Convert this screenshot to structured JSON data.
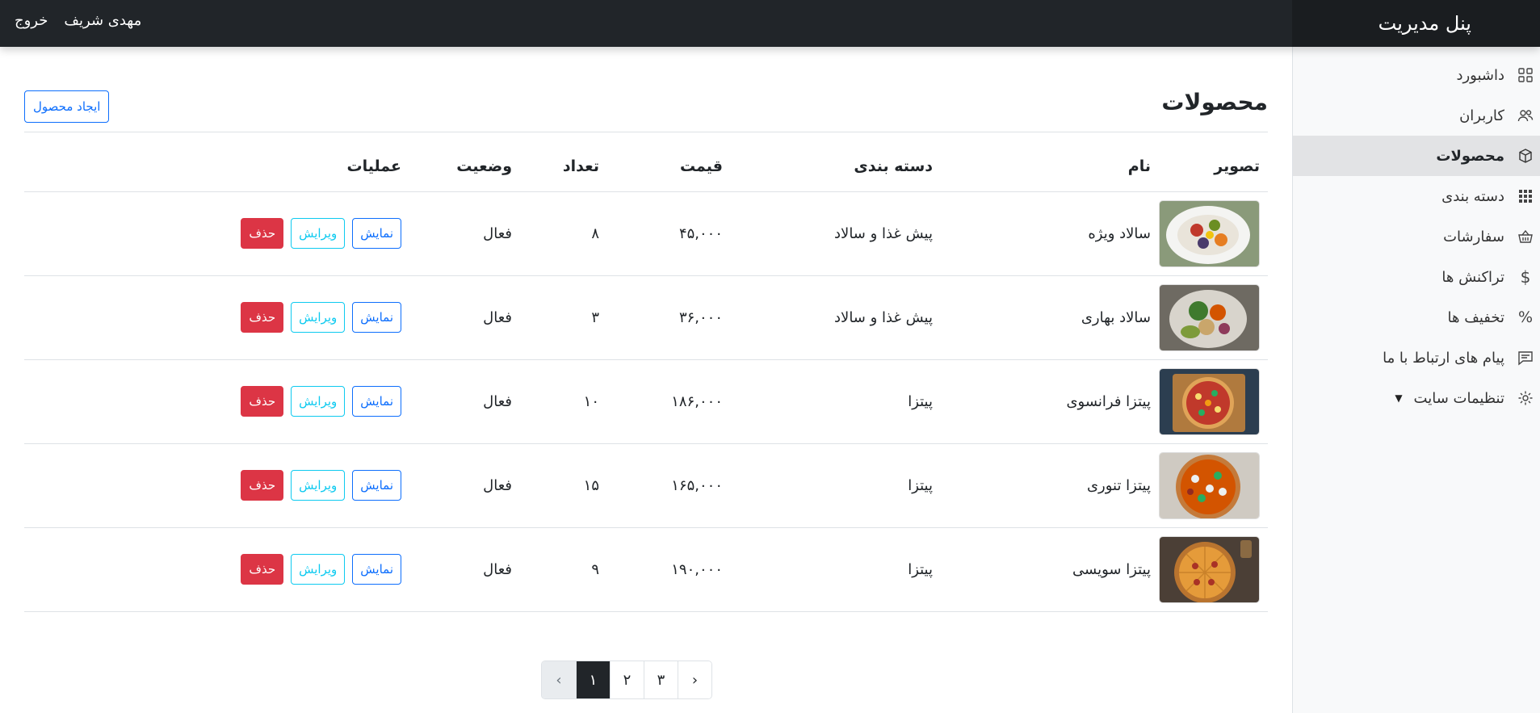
{
  "brand": "پنل مدیریت",
  "user": {
    "name": "مهدی شریف",
    "logout": "خروج"
  },
  "sidebar": {
    "items": [
      {
        "label": "داشبورد",
        "icon": "grid-icon"
      },
      {
        "label": "کاربران",
        "icon": "users-icon"
      },
      {
        "label": "محصولات",
        "icon": "box-icon",
        "active": true
      },
      {
        "label": "دسته بندی",
        "icon": "apps-grid-icon"
      },
      {
        "label": "سفارشات",
        "icon": "basket-icon"
      },
      {
        "label": "تراکنش ها",
        "icon": "dollar-icon"
      },
      {
        "label": "تخفیف ها",
        "icon": "percent-icon"
      },
      {
        "label": "پیام های ارتباط با ما",
        "icon": "message-icon"
      },
      {
        "label": "تنظیمات سایت",
        "icon": "gear-icon",
        "dropdown": true
      }
    ]
  },
  "main": {
    "title": "محصولات",
    "create_label": "ایجاد محصول",
    "columns": [
      "تصویر",
      "نام",
      "دسته بندی",
      "قیمت",
      "تعداد",
      "وضعیت",
      "عملیات"
    ],
    "action_labels": {
      "show": "نمایش",
      "edit": "ویرایش",
      "delete": "حذف"
    },
    "rows": [
      {
        "name": "سالاد ویژه",
        "category": "پیش غذا و سالاد",
        "price": "۴۵,۰۰۰",
        "qty": "۸",
        "status": "فعال",
        "image": "salad-white-bowl"
      },
      {
        "name": "سالاد بهاری",
        "category": "پیش غذا و سالاد",
        "price": "۳۶,۰۰۰",
        "qty": "۳",
        "status": "فعال",
        "image": "salad-green-bowl"
      },
      {
        "name": "پیتزا فرانسوی",
        "category": "پیتزا",
        "price": "۱۸۶,۰۰۰",
        "qty": "۱۰",
        "status": "فعال",
        "image": "pizza-board"
      },
      {
        "name": "پیتزا تنوری",
        "category": "پیتزا",
        "price": "۱۶۵,۰۰۰",
        "qty": "۱۵",
        "status": "فعال",
        "image": "pizza-oven"
      },
      {
        "name": "پیتزا سویسی",
        "category": "پیتزا",
        "price": "۱۹۰,۰۰۰",
        "qty": "۹",
        "status": "فعال",
        "image": "pizza-cheese"
      }
    ]
  },
  "pagination": {
    "prev": "‹",
    "pages": [
      "۱",
      "۲",
      "۳"
    ],
    "next": "›",
    "current": 0
  },
  "colors": {
    "primary": "#0d6efd",
    "info": "#0dcaf0",
    "danger": "#dc3545",
    "dark": "#212529"
  }
}
